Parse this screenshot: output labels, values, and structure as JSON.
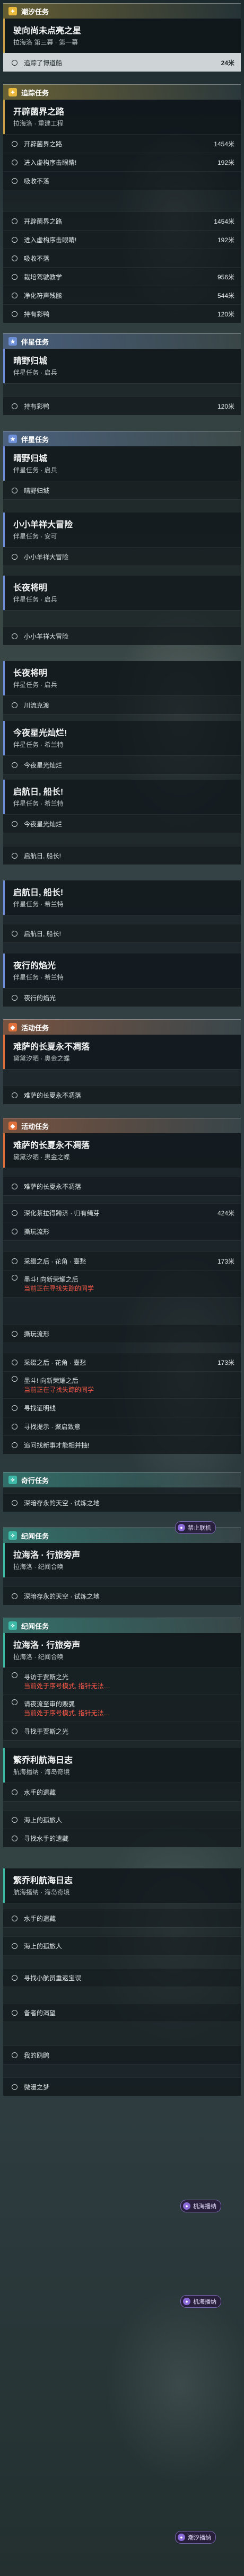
{
  "headers": {
    "chaoxi": "潮汐任务",
    "tracking": "追踪任务",
    "companion": "伴星任务",
    "event": "活动任务",
    "explore": "奇行任务",
    "discipline": "纪闻任务"
  },
  "b1": {
    "title": "驶向尚未点亮之星",
    "sub": "拉海洛 第三幕 · 第一幕",
    "r1": "追踪了博道船",
    "r1d": "24米"
  },
  "b2": {
    "title": "开辟菌界之路",
    "sub": "拉海洛 · 重建工程",
    "r1": "开辟菌界之路",
    "r1d": "1454米",
    "r2": "进入虚构序击眼睛!",
    "r2d": "192米",
    "r3": "吸收不落"
  },
  "b3": {
    "r1": "开辟菌界之路",
    "r1d": "1454米",
    "r2": "进入虚构序击眼睛!",
    "r2d": "192米",
    "r3": "吸收不落",
    "r4": "栽培驾驶教学",
    "r4d": "956米",
    "r5": "净化符声残骸",
    "r5d": "544米",
    "r6": "持有彩鸭",
    "r6d": "120米"
  },
  "b4": {
    "title": "晴野归城",
    "sub": "伴星任务 · 启兵",
    "r1": "持有彩鸭",
    "r1d": "120米"
  },
  "b5": {
    "title": "晴野归城",
    "sub": "伴星任务 · 启兵",
    "r1": "晴野归城"
  },
  "b6": {
    "title": "小小羊祥大冒险",
    "sub": "伴星任务 · 安可",
    "r1": "小小羊祥大冒险"
  },
  "b7": {
    "title": "长夜将明",
    "sub": "伴星任务 · 启兵",
    "r1": "小小羊祥大冒险"
  },
  "b8": {
    "title": "长夜将明",
    "sub": "伴星任务 · 启兵",
    "r1": "川流克渡"
  },
  "b9": {
    "title": "今夜星光灿烂!",
    "sub": "伴星任务 · 希兰特",
    "r1": "今夜星光灿烂"
  },
  "b10": {
    "title": "启航日, 船长!",
    "sub": "伴星任务 · 希兰特",
    "r1": "今夜星光灿烂",
    "r2": "启航日, 船长!"
  },
  "b11": {
    "title": "启航日, 船长!",
    "sub": "伴星任务 · 希兰特",
    "r1": "启航日, 船长!"
  },
  "b12": {
    "title": "夜行的焰光",
    "sub": "伴星任务 · 希兰特",
    "r1": "夜行的焰光"
  },
  "b13": {
    "title": "难萨的长夏永不凋落",
    "sub": "黛黛汐晒 · 奥金之蝶",
    "r1": "难萨的长夏永不凋落"
  },
  "b14": {
    "title": "难萨的长夏永不凋落",
    "sub": "黛黛汐晒 · 奥金之蝶",
    "r1": "难萨的长夏永不凋落",
    "r2": "深化茶拉得跨济 · 归有绳芽",
    "r2d": "424米",
    "r3": "撕玩流形",
    "r4": "采缀之后 · 花角 · 臺愁",
    "r4d": "173米",
    "r5a": "墨斗! 向新荣耀之后",
    "r5b": "当前正在寻找失踪的同学"
  },
  "b15": {
    "r1": "撕玩流形",
    "r2": "采缀之后 · 花角 · 臺愁",
    "r2d": "173米",
    "r3a": "墨斗! 向新荣耀之后",
    "r3b": "当前正在寻找失踪的同学",
    "r4": "寻找证明线",
    "r5": "寻找提示 · 聚启致意",
    "r6": "追问找新事才能相并抽!"
  },
  "b16": {
    "title": "",
    "r1": "深暗存永的天空 · 试炼之地"
  },
  "b17": {
    "title": "拉海洛 · 行旅旁声",
    "sub": "拉海洛 · 纪闻合唤",
    "r1": "深暗存永的天空 · 试炼之地"
  },
  "b18": {
    "title": "拉海洛 · 行旅旁声",
    "sub": "拉海洛 · 纪闻合唤",
    "r1a": "寻访于贾斯之光",
    "r1b": "当前处于序号模式, 指针无法…",
    "r2a": "请夜流至审的贩弧",
    "r2b": "当前处于序号模式, 指针无法…",
    "r3": "寻找于贾斯之光"
  },
  "b19": {
    "title": "繁乔利航海日志",
    "sub": "航海播纳 · 海岛奇境",
    "r1": "水手的遗藏",
    "r2": "海上的孤旅人",
    "r3": "寻找水手的遗藏"
  },
  "b20": {
    "title": "繁乔利航海日志",
    "sub": "航海播纳 · 海岛奇境",
    "r1": "水手的遗藏",
    "r2": "海上的孤旅人",
    "r3": "寻找小航员重返宝误",
    "r4": "备者的渴望",
    "r5": "我的鸥鸥",
    "r6": "微漫之梦"
  },
  "chips": {
    "c1": "禁止联机",
    "c2": "机海播纳",
    "c3": "机海播纳",
    "c4": "潮汐播纳"
  }
}
